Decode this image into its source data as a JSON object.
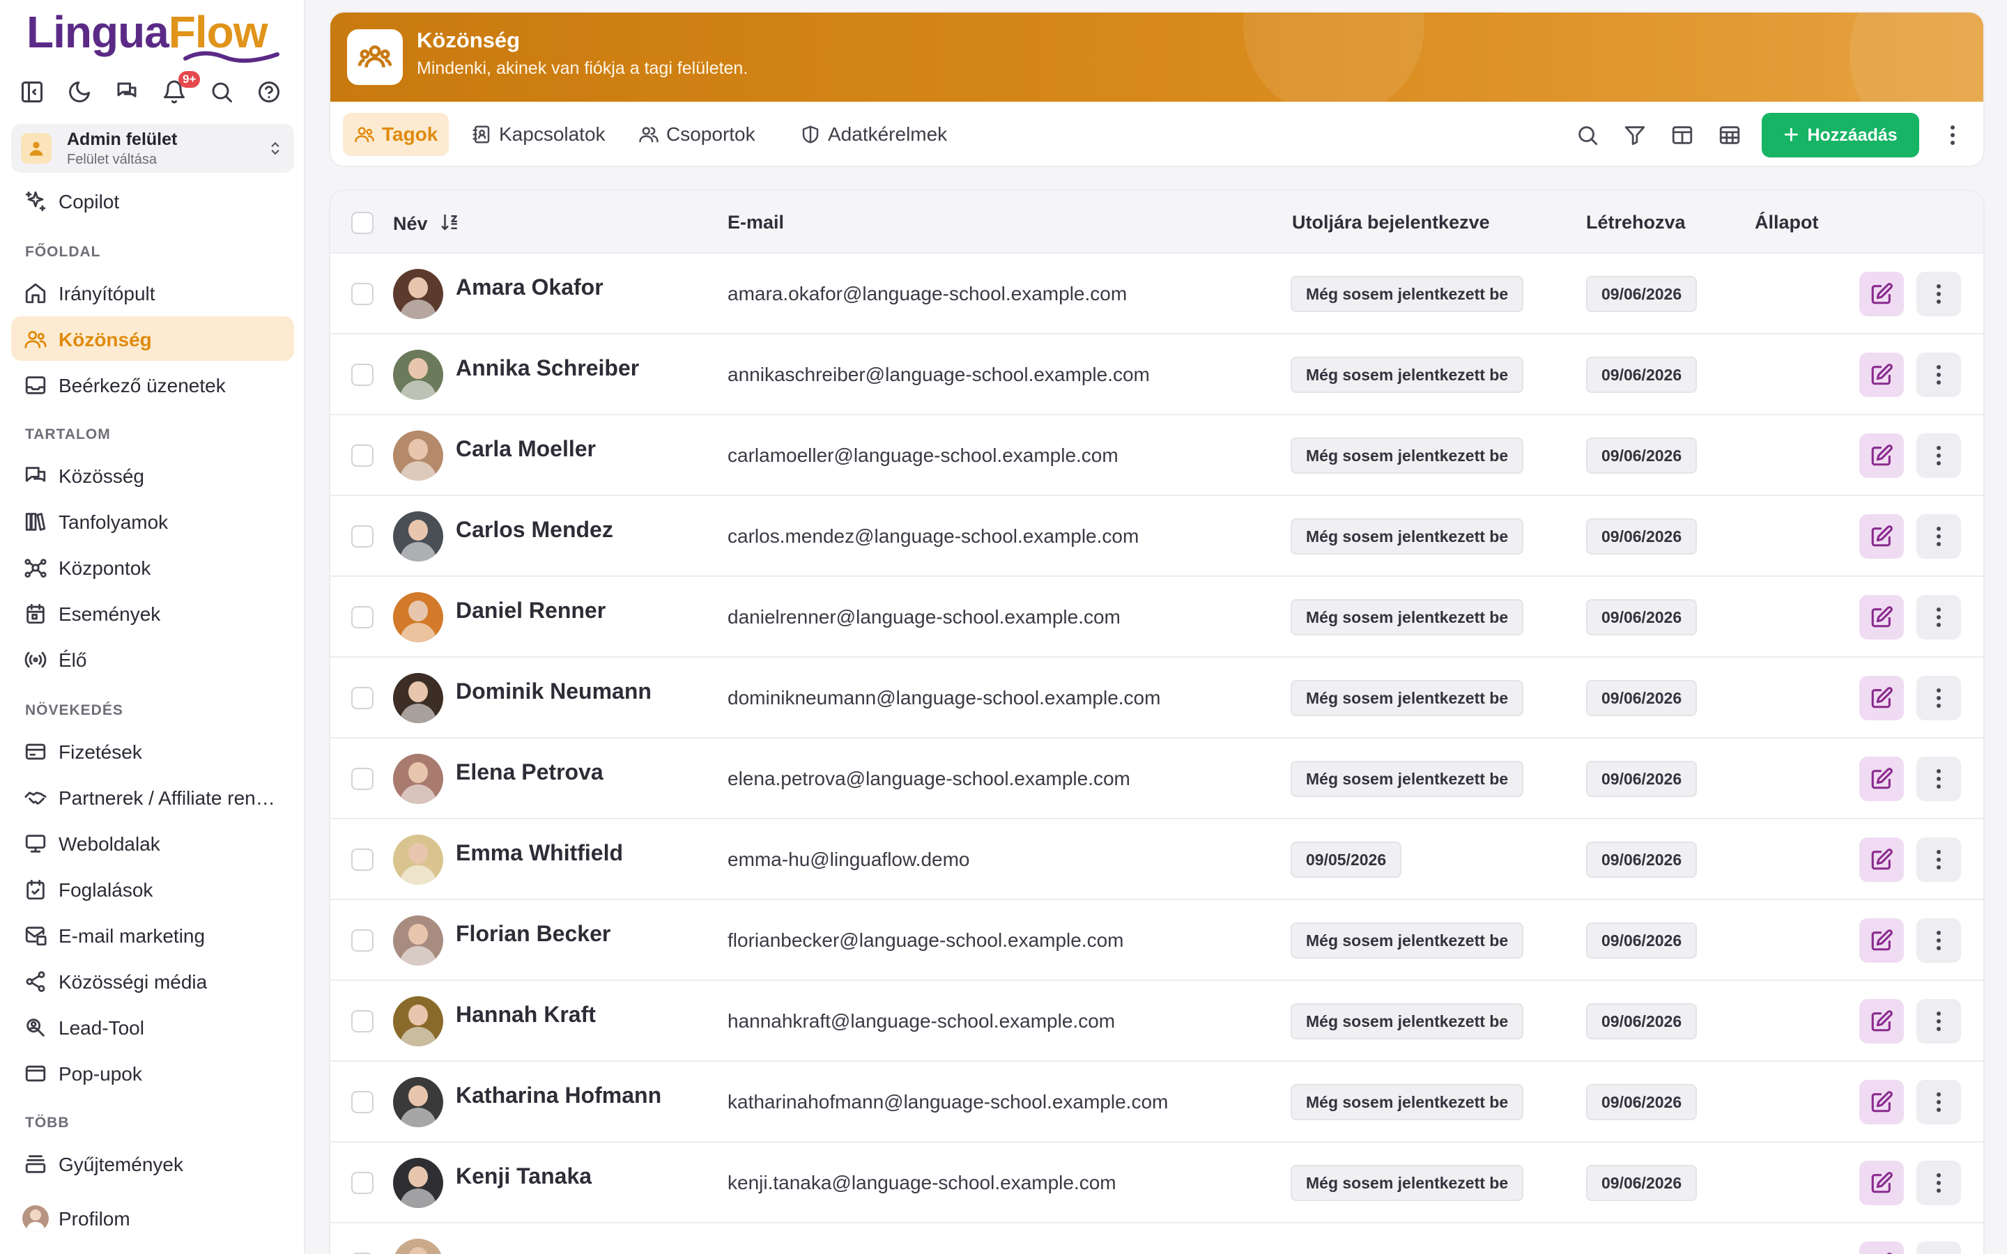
{
  "brand": {
    "part1": "Lingua",
    "part2": "Flow"
  },
  "top_icons": {
    "notification_badge": "9+"
  },
  "switcher": {
    "title": "Admin felület",
    "subtitle": "Felület váltása"
  },
  "copilot_label": "Copilot",
  "sections": {
    "home": "FŐOLDAL",
    "content": "TARTALOM",
    "growth": "NÖVEKEDÉS",
    "more": "TÖBB"
  },
  "nav": {
    "dashboard": "Irányítópult",
    "audience": "Közönség",
    "inbox": "Beérkező üzenetek",
    "community": "Közösség",
    "courses": "Tanfolyamok",
    "hubs": "Központok",
    "events": "Események",
    "live": "Élő",
    "payments": "Fizetések",
    "affiliates": "Partnerek / Affiliate ren…",
    "websites": "Weboldalak",
    "bookings": "Foglalások",
    "email_marketing": "E-mail marketing",
    "social": "Közösségi média",
    "lead_tool": "Lead-Tool",
    "popups": "Pop-upok",
    "collections": "Gyűjtemények",
    "profile": "Profilom"
  },
  "header": {
    "title": "Közönség",
    "subtitle": "Mindenki, akinek van fiókja a tagi felületen.",
    "tabs": {
      "members": "Tagok",
      "contacts": "Kapcsolatok",
      "groups": "Csoportok",
      "data_requests": "Adatkérelmek"
    },
    "add_button": "Hozzáadás"
  },
  "table": {
    "columns": {
      "name": "Név",
      "email": "E-mail",
      "last_login": "Utoljára bejelentkezve",
      "created": "Létrehozva",
      "status": "Állapot"
    },
    "rows": [
      {
        "name": "Amara Okafor",
        "email": "amara.okafor@language-school.example.com",
        "last_login": "Még sosem jelentkezett be",
        "created": "09/06/2026",
        "avatar_color": "#5c3b2e"
      },
      {
        "name": "Annika Schreiber",
        "email": "annikaschreiber@language-school.example.com",
        "last_login": "Még sosem jelentkezett be",
        "created": "09/06/2026",
        "avatar_color": "#6b7a5a"
      },
      {
        "name": "Carla Moeller",
        "email": "carlamoeller@language-school.example.com",
        "last_login": "Még sosem jelentkezett be",
        "created": "09/06/2026",
        "avatar_color": "#b48a6a"
      },
      {
        "name": "Carlos Mendez",
        "email": "carlos.mendez@language-school.example.com",
        "last_login": "Még sosem jelentkezett be",
        "created": "09/06/2026",
        "avatar_color": "#4a4e55"
      },
      {
        "name": "Daniel Renner",
        "email": "danielrenner@language-school.example.com",
        "last_login": "Még sosem jelentkezett be",
        "created": "09/06/2026",
        "avatar_color": "#d27a2a"
      },
      {
        "name": "Dominik Neumann",
        "email": "dominikneumann@language-school.example.com",
        "last_login": "Még sosem jelentkezett be",
        "created": "09/06/2026",
        "avatar_color": "#3d2e25"
      },
      {
        "name": "Elena Petrova",
        "email": "elena.petrova@language-school.example.com",
        "last_login": "Még sosem jelentkezett be",
        "created": "09/06/2026",
        "avatar_color": "#a97a6e"
      },
      {
        "name": "Emma Whitfield",
        "email": "emma-hu@linguaflow.demo",
        "last_login": "09/05/2026",
        "created": "09/06/2026",
        "avatar_color": "#d9c48f"
      },
      {
        "name": "Florian Becker",
        "email": "florianbecker@language-school.example.com",
        "last_login": "Még sosem jelentkezett be",
        "created": "09/06/2026",
        "avatar_color": "#a88c80"
      },
      {
        "name": "Hannah Kraft",
        "email": "hannahkraft@language-school.example.com",
        "last_login": "Még sosem jelentkezett be",
        "created": "09/06/2026",
        "avatar_color": "#8a6a2a"
      },
      {
        "name": "Katharina Hofmann",
        "email": "katharinahofmann@language-school.example.com",
        "last_login": "Még sosem jelentkezett be",
        "created": "09/06/2026",
        "avatar_color": "#3a3a3a"
      },
      {
        "name": "Kenji Tanaka",
        "email": "kenji.tanaka@language-school.example.com",
        "last_login": "Még sosem jelentkezett be",
        "created": "09/06/2026",
        "avatar_color": "#2f2f33"
      },
      {
        "name": "",
        "email": "",
        "last_login": "",
        "created": "",
        "avatar_color": "#c9a98a"
      }
    ]
  },
  "colors": {
    "accent": "#e08a0d",
    "brand_purple": "#5b2a86",
    "add_green": "#16b464",
    "edit_purple": "#8a2a8e"
  }
}
